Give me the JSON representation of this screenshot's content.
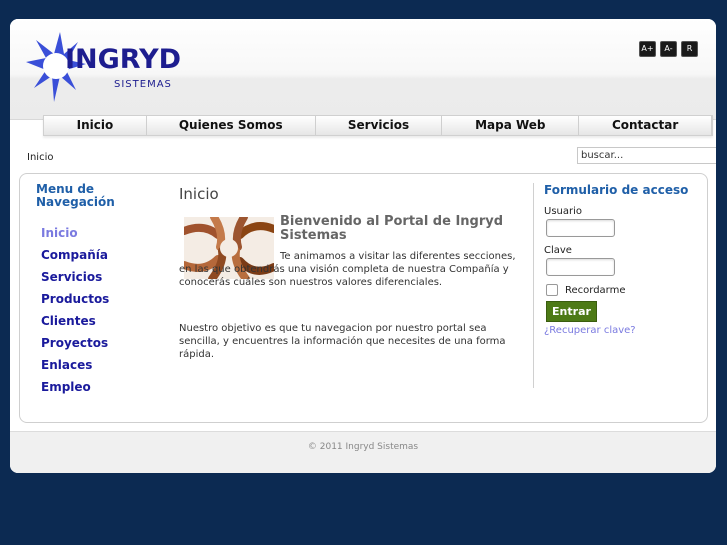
{
  "brand": {
    "name": "INGRYD",
    "sub": "SISTEMAS",
    "color": "#1d1d8f"
  },
  "font_controls": [
    "A+",
    "A-",
    "R"
  ],
  "nav": [
    {
      "label": "Inicio"
    },
    {
      "label": "Quienes Somos"
    },
    {
      "label": "Servicios"
    },
    {
      "label": "Mapa Web"
    },
    {
      "label": "Contactar"
    }
  ],
  "breadcrumb": "Inicio",
  "search": {
    "value": "buscar..."
  },
  "sidebar": {
    "title": "Menu de Navegación",
    "items": [
      {
        "label": "Inicio",
        "active": true
      },
      {
        "label": "Compañía"
      },
      {
        "label": "Servicios"
      },
      {
        "label": "Productos"
      },
      {
        "label": "Clientes"
      },
      {
        "label": "Proyectos"
      },
      {
        "label": "Enlaces"
      },
      {
        "label": "Empleo"
      }
    ]
  },
  "main": {
    "page_title": "Inicio",
    "welcome_title": "Bienvenido al Portal de Ingryd Sistemas",
    "paragraph1": "Te animamos a visitar las diferentes secciones, en las que obtendrás una visión completa de nuestra Compañía y conocerás cuáles son nuestros valores diferenciales.",
    "paragraph2": "Nuestro objetivo es que tu navegacion por nuestro portal sea sencilla, y encuentres la información que necesites de una forma rápida.",
    "image": "hands-circle-teamwork-image"
  },
  "login": {
    "title": "Formulario de acceso",
    "user_label": "Usuario",
    "pass_label": "Clave",
    "remember_label": "Recordarme",
    "submit_label": "Entrar",
    "recover_label": "¿Recuperar clave?"
  },
  "footer": {
    "copyright": "© 2011 Ingryd Sistemas"
  },
  "colors": {
    "background": "#0c2a52",
    "link": "#1a1a9c",
    "heading": "#1f5fa8",
    "button": "#4d7a16"
  }
}
